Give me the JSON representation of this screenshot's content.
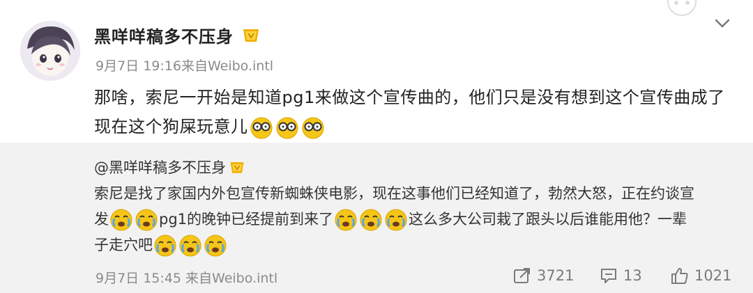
{
  "post": {
    "username": "黑咩咩稿多不压身",
    "date": "9月7日 19:16",
    "source": "来自Weibo.intl",
    "text": "那啥，索尼一开始是知道pg1来做这个宣传曲的，他们只是没有想到这个宣传曲成了现在这个狗屎玩意儿",
    "trailing_emojis": [
      "glasses-face-emoji",
      "glasses-face-emoji",
      "glasses-face-emoji"
    ]
  },
  "repost": {
    "mention": "@黑咩咩稿多不压身",
    "line1": "索尼是找了家国内外包宣传新蜘蛛侠电影，现在这事他们已经知道了，勃然大怒，正在约谈宣",
    "seg_a": "发",
    "seg_b": "pg1的晚钟已经提前到来了",
    "seg_c": "这么多大公司栽了跟头以后谁能用他？一辈",
    "seg_d": "子走穴吧",
    "date": "9月7日 15:45",
    "source": "来自Weibo.intl",
    "actions": {
      "repost_count": "3721",
      "comment_count": "13",
      "like_count": "1021"
    }
  },
  "colors": {
    "repost_background": "#f2f2f2",
    "meta_text": "#8a8a8a",
    "emoji_yellow": "#f5c518"
  }
}
